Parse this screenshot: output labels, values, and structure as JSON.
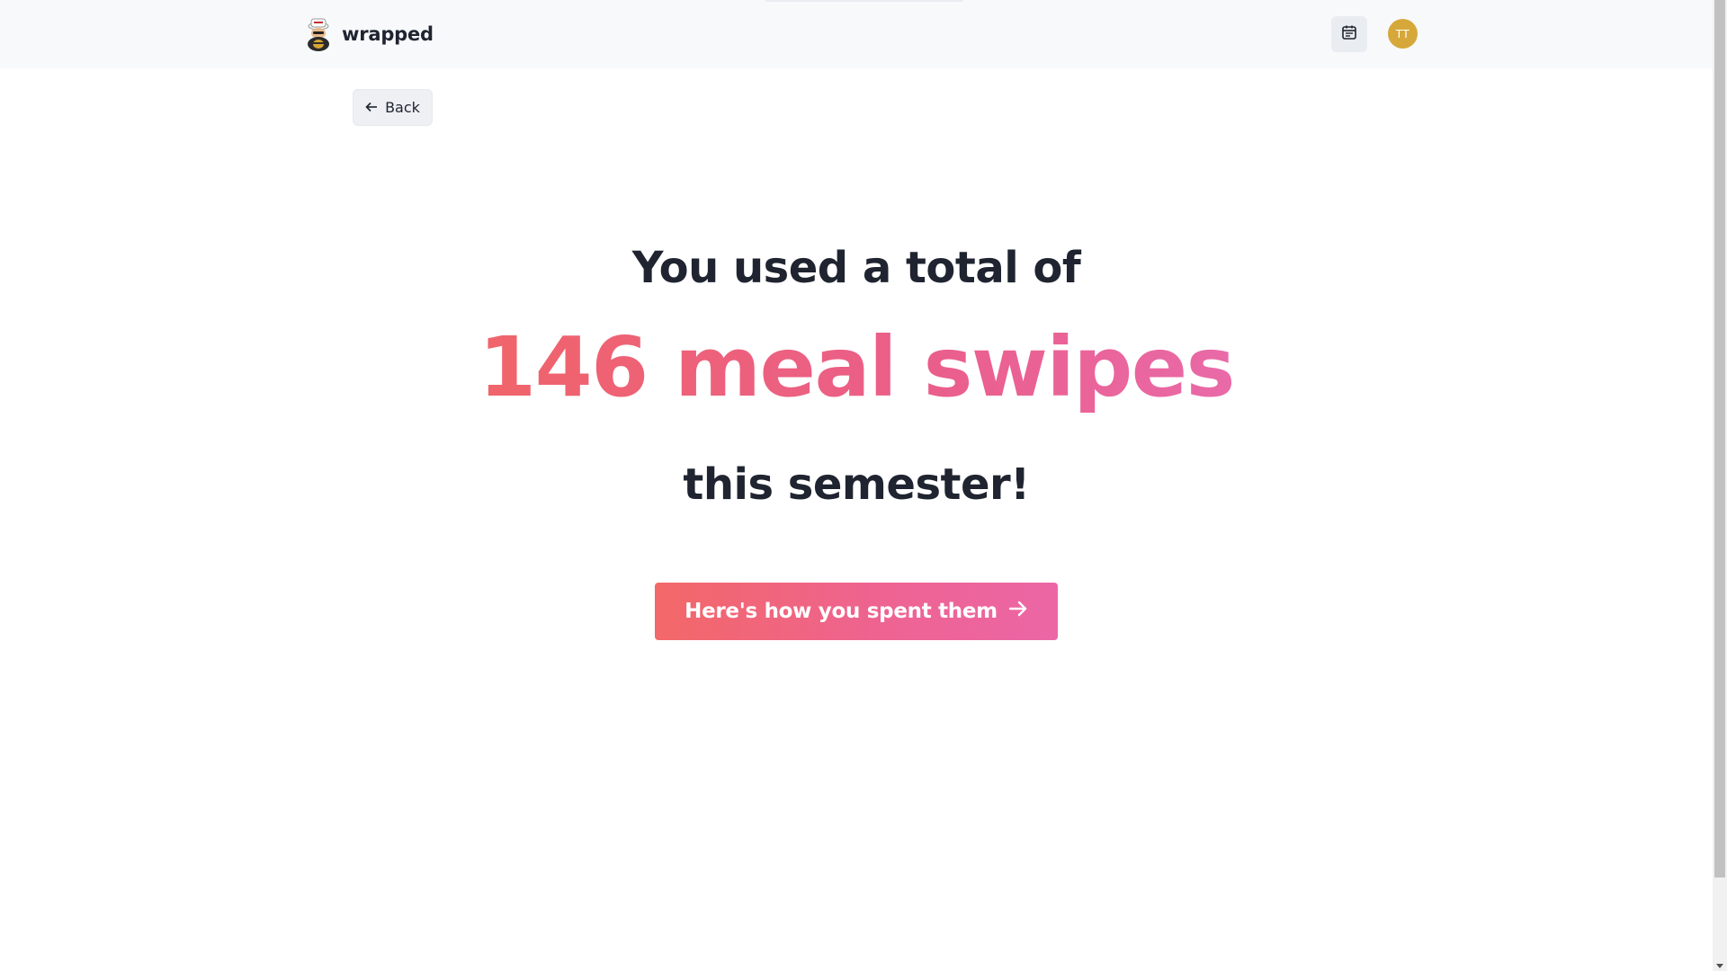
{
  "header": {
    "brand_name": "wrapped",
    "brand_logo_icon": "bee-mascot-icon",
    "calendar_icon": "calendar-icon",
    "avatar_initials": "TT",
    "avatar_color": "#d6a83a"
  },
  "back_button": {
    "label": "Back",
    "icon": "arrow-left-icon"
  },
  "main": {
    "line_top": "You used a total of",
    "line_highlight": "146 meal swipes",
    "line_bottom": "this semester!",
    "cta_label": "Here's how you spent them",
    "cta_icon": "arrow-right-icon"
  },
  "colors": {
    "accent_start": "#f36868",
    "accent_end": "#ec66a6",
    "text_dark": "#1f2430"
  }
}
